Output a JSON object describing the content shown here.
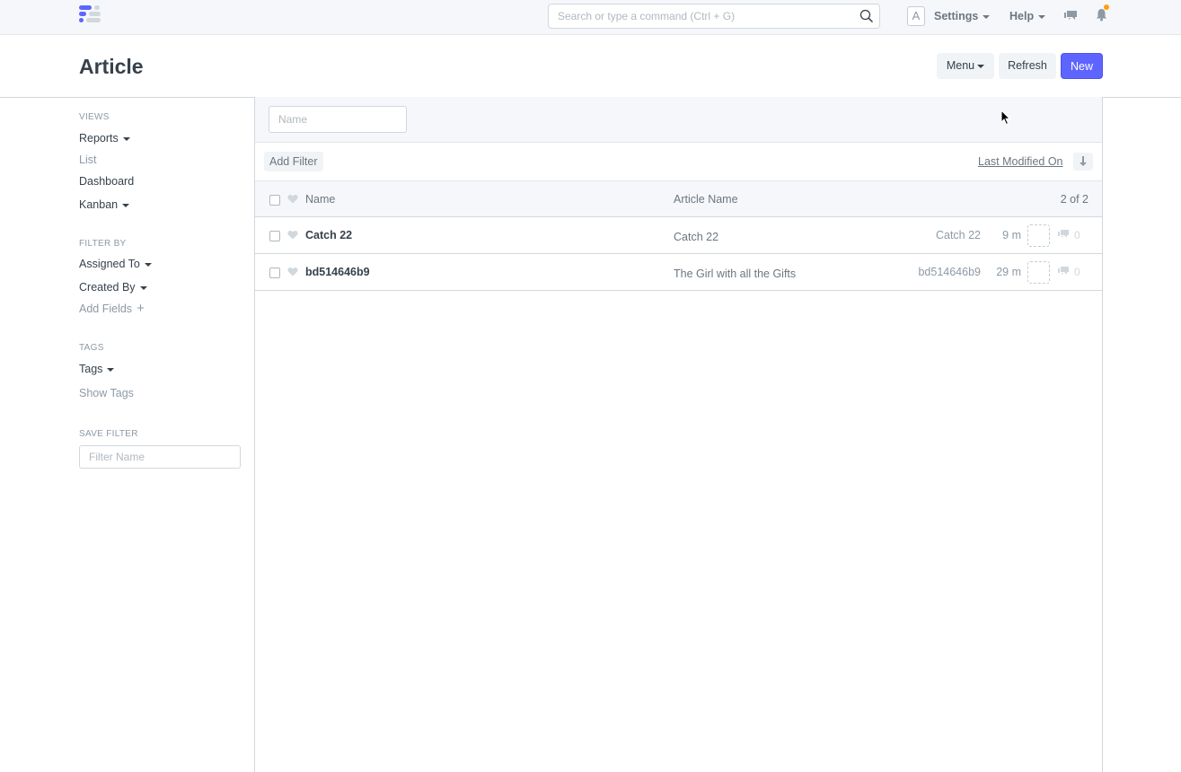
{
  "navbar": {
    "search_placeholder": "Search or type a command (Ctrl + G)",
    "avatar_initial": "A",
    "settings_label": "Settings",
    "help_label": "Help",
    "icons": [
      "app-logo-icon",
      "search-icon",
      "chat-icon",
      "bell-icon"
    ],
    "notification_dot_color": "#ff9f0a"
  },
  "page": {
    "title": "Article",
    "actions": {
      "menu_label": "Menu",
      "refresh_label": "Refresh",
      "new_label": "New"
    },
    "primary_color": "#5e64ff"
  },
  "sidebar": {
    "views_heading": "VIEWS",
    "views": [
      {
        "label": "Reports",
        "dropdown": true
      },
      {
        "label": "List",
        "dropdown": false
      },
      {
        "label": "Dashboard",
        "dropdown": false
      },
      {
        "label": "Kanban",
        "dropdown": true
      }
    ],
    "filter_heading": "FILTER BY",
    "filters": [
      {
        "label": "Assigned To",
        "dropdown": true
      },
      {
        "label": "Created By",
        "dropdown": true
      }
    ],
    "add_fields_label": "Add Fields",
    "tags_heading": "TAGS",
    "tags_label": "Tags",
    "show_tags_label": "Show Tags",
    "save_filter_heading": "SAVE FILTER",
    "filter_name_placeholder": "Filter Name"
  },
  "list": {
    "name_filter_placeholder": "Name",
    "add_filter_label": "Add Filter",
    "sort_label": "Last Modified On",
    "columns": {
      "name": "Name",
      "article_name": "Article Name"
    },
    "count_label": "2 of 2",
    "rows": [
      {
        "name": "Catch 22",
        "article_name": "Catch 22",
        "title": "Catch 22",
        "modified": "9 m",
        "comments": "0"
      },
      {
        "name": "bd514646b9",
        "article_name": "The Girl with all the Gifts",
        "title": "bd514646b9",
        "modified": "29 m",
        "comments": "0"
      }
    ]
  }
}
